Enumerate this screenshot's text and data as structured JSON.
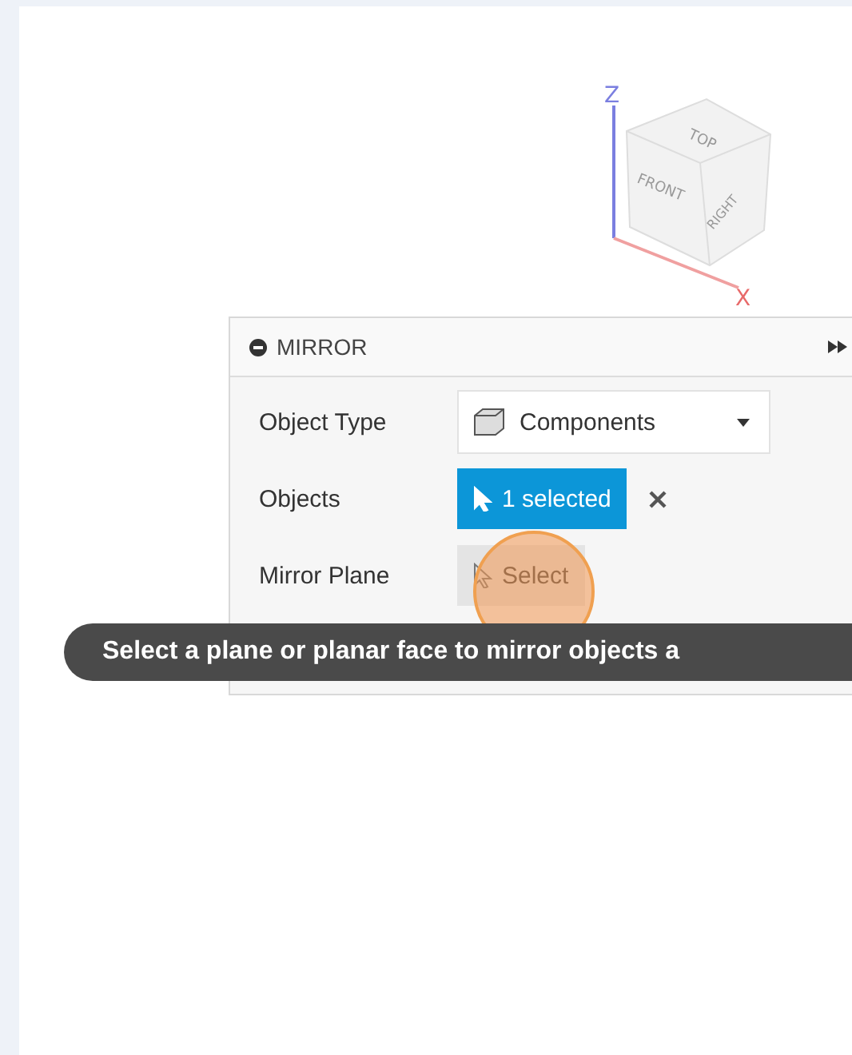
{
  "view_cube": {
    "faces": [
      "TOP",
      "FRONT",
      "RIGHT"
    ],
    "axes": [
      "Z",
      "X"
    ]
  },
  "panel": {
    "title": "MIRROR",
    "rows": [
      {
        "kind": "dropdown",
        "label": "Object Type",
        "value": "Components"
      },
      {
        "kind": "selection",
        "label": "Objects",
        "value": "1 selected",
        "selected": true
      },
      {
        "kind": "selection",
        "label": "Mirror Plane",
        "value": "Select",
        "selected": false,
        "highlighted": true
      }
    ]
  },
  "tooltip": "Select a plane or planar face to mirror objects a"
}
